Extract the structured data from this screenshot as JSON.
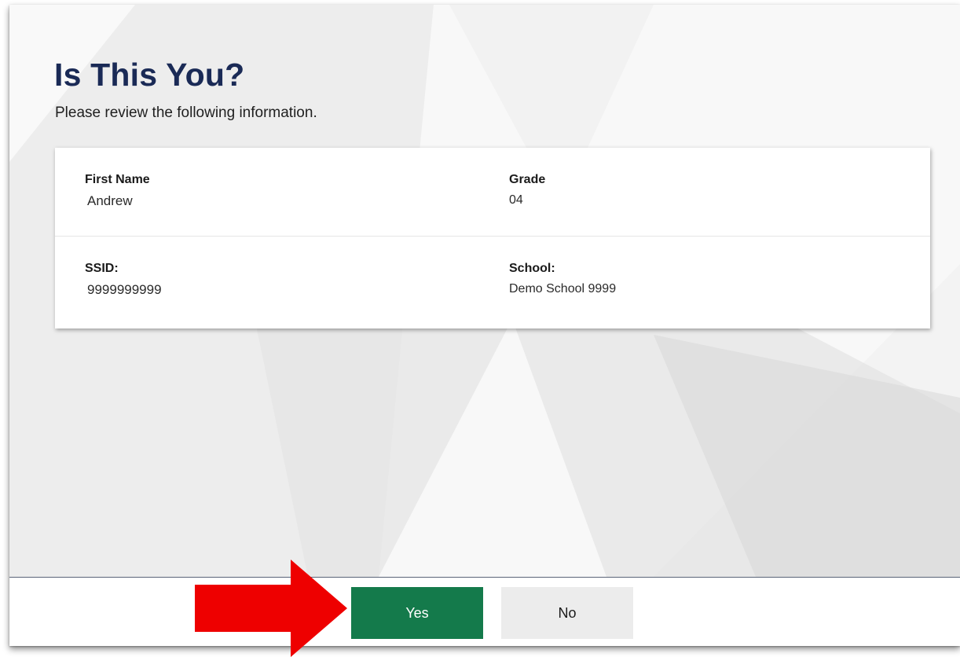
{
  "page": {
    "title": "Is This You?",
    "subtitle": "Please review the following information."
  },
  "student": {
    "fields": [
      {
        "label": "First Name",
        "value": "Andrew"
      },
      {
        "label": "Grade",
        "value": "04"
      },
      {
        "label": "SSID:",
        "value": "9999999999"
      },
      {
        "label": "School:",
        "value": "Demo School 9999"
      }
    ]
  },
  "actions": {
    "yes_label": "Yes",
    "no_label": "No"
  },
  "colors": {
    "title": "#1a2a56",
    "yes_button": "#147a4b",
    "no_button": "#ececec",
    "annotation_arrow": "#ee0000"
  },
  "icons": {
    "annotation": "red-right-arrow-icon"
  }
}
